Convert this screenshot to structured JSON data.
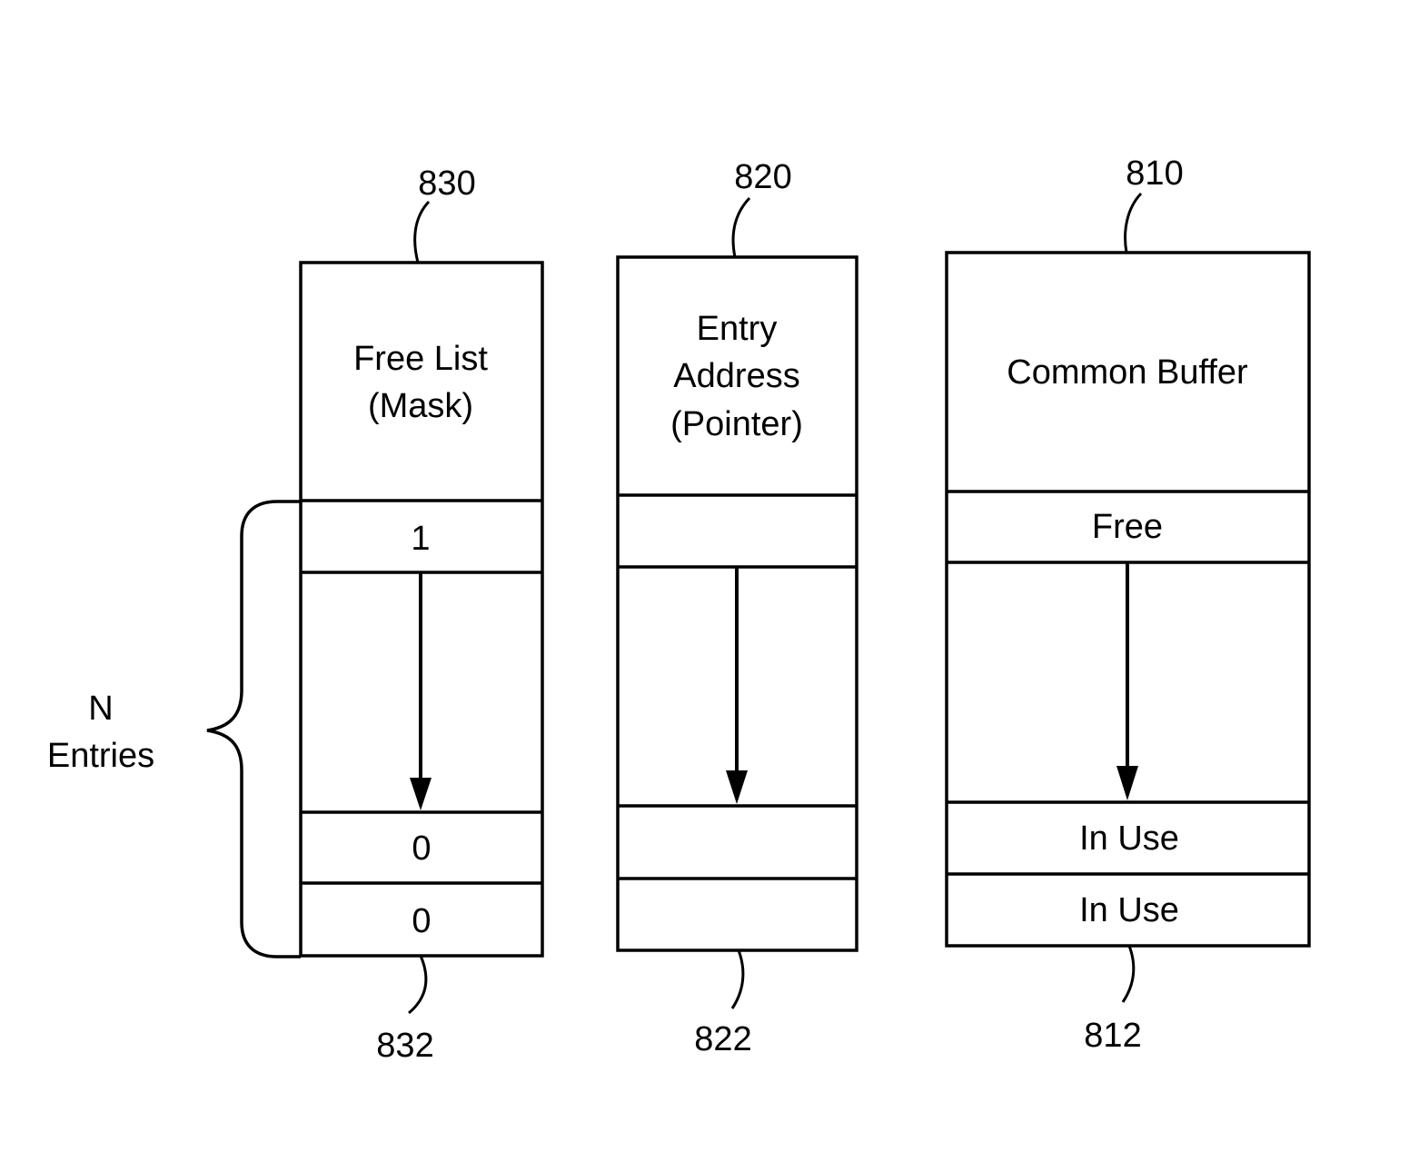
{
  "diagram": {
    "columns": [
      {
        "id": "free-list",
        "reference_top": "830",
        "reference_bottom": "832",
        "title_lines": [
          "Free List",
          "(Mask)"
        ],
        "cells": [
          "1",
          "0",
          "0"
        ]
      },
      {
        "id": "entry-address",
        "reference_top": "820",
        "reference_bottom": "822",
        "title_lines": [
          "Entry",
          "Address",
          "(Pointer)"
        ],
        "cells": [
          "",
          "",
          ""
        ]
      },
      {
        "id": "common-buffer",
        "reference_top": "810",
        "reference_bottom": "812",
        "title_lines": [
          "Common Buffer"
        ],
        "cells": [
          "Free",
          "In Use",
          "In Use"
        ]
      }
    ],
    "brace_label_lines": [
      "N",
      "Entries"
    ]
  }
}
